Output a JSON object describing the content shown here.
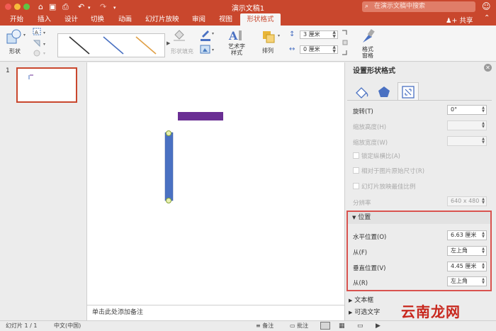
{
  "window": {
    "title": "演示文稿1"
  },
  "quick_access": {
    "home_icon": "home-icon",
    "save_icon": "save-icon",
    "undo_icon": "undo-icon",
    "redo_icon": "redo-icon",
    "more_icon": "chevron-down-icon"
  },
  "search": {
    "placeholder": "在演示文稿中搜索"
  },
  "tabs": [
    {
      "label": "开始"
    },
    {
      "label": "插入"
    },
    {
      "label": "设计"
    },
    {
      "label": "切换"
    },
    {
      "label": "动画"
    },
    {
      "label": "幻灯片放映"
    },
    {
      "label": "审阅"
    },
    {
      "label": "视图"
    },
    {
      "label": "形状格式",
      "active": true
    }
  ],
  "share": {
    "label": "共享"
  },
  "ribbon": {
    "shape_label": "形状",
    "fill_label": "形状填充",
    "wordart_label": "艺术字\n样式",
    "arrange_label": "排列",
    "height_value": "3 厘米",
    "width_value": "0 厘米",
    "format_pane_label": "格式\n窗格"
  },
  "slides": {
    "number": "1"
  },
  "notes": {
    "placeholder": "单击此处添加备注"
  },
  "format_pane": {
    "title": "设置形状格式",
    "rows": {
      "rotation_label": "旋转(T)",
      "rotation_value": "0°",
      "scale_height_label": "缩放高度(H)",
      "scale_width_label": "缩放宽度(W)",
      "lock_ratio_label": "锁定纵横比(A)",
      "relative_label": "相对于图片原始尺寸(R)",
      "best_scale_label": "幻灯片放映最佳比例",
      "resolution_label": "分辨率",
      "resolution_value": "640 x 480"
    },
    "position": {
      "header": "位置",
      "h_pos_label": "水平位置(O)",
      "h_pos_value": "6.63 厘米",
      "h_from_label": "从(F)",
      "h_from_value": "左上角",
      "v_pos_label": "垂直位置(V)",
      "v_pos_value": "4.45 厘米",
      "v_from_label": "从(R)",
      "v_from_value": "左上角"
    },
    "textbox_label": "文本框",
    "alt_text_label": "可选文字"
  },
  "status": {
    "slide": "幻灯片 1 / 1",
    "lang": "中文(中国)",
    "notes_btn": "备注",
    "comments_btn": "批注"
  },
  "watermark": "云南龙网",
  "colors": {
    "accent": "#c9472d",
    "bar_purple": "#6a2f94",
    "bar_blue": "#4a71c2",
    "highlight": "#d9534f"
  }
}
